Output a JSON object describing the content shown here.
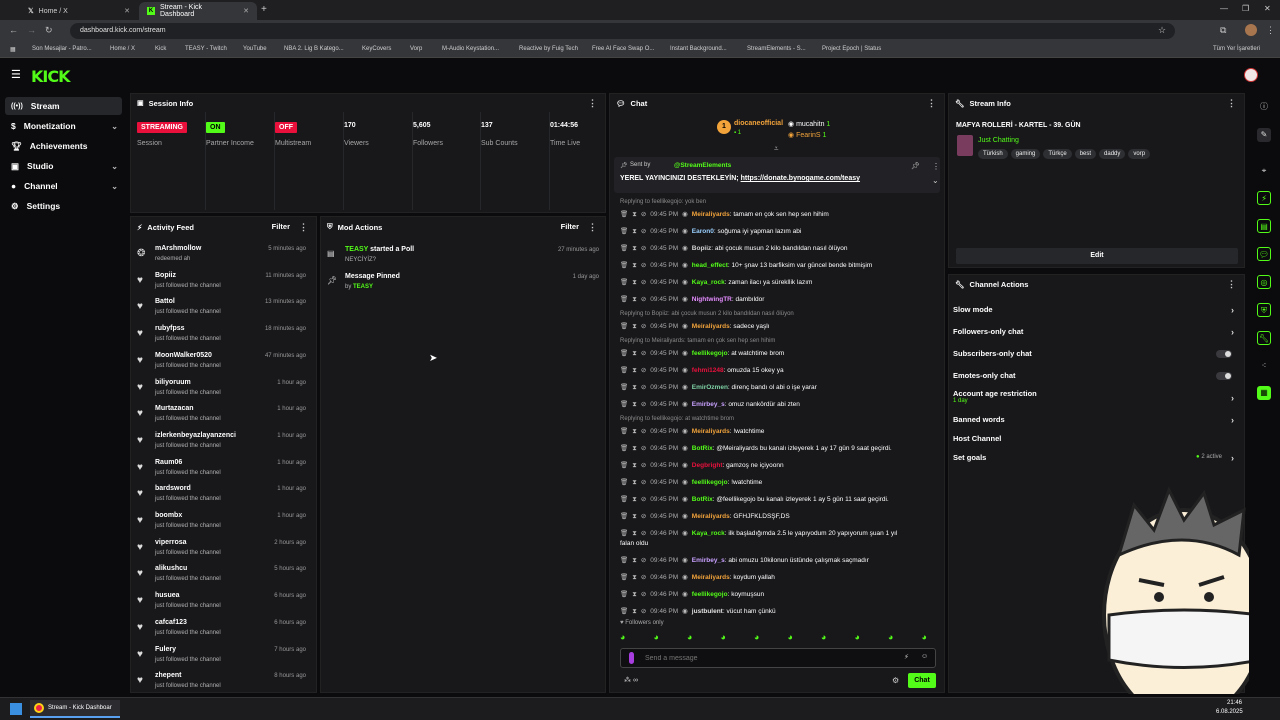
{
  "browser": {
    "tabs": [
      {
        "label": "Home / X",
        "icon": "x-icon"
      },
      {
        "label": "Stream - Kick Dashboard",
        "icon": "kick-icon"
      }
    ],
    "url": "dashboard.kick.com/stream",
    "bookmarks": [
      "Son Mesajlar - Patro...",
      "Home / X",
      "Kick",
      "TEASY - Twitch",
      "YouTube",
      "NBA 2. Lig B Katego...",
      "KeyCovers",
      "Vorp",
      "M-Audio Keystation...",
      "Reactive by Fuig Tech",
      "Free AI Face Swap O...",
      "Instant Background...",
      "StreamElements - S...",
      "Project Epoch | Status"
    ],
    "all_bookmarks": "Tüm Yer İşaretleri"
  },
  "logo": "KICK",
  "nav": [
    {
      "label": "Stream",
      "icon": "stream-icon",
      "active": true
    },
    {
      "label": "Monetization",
      "icon": "dollar-icon"
    },
    {
      "label": "Achievements",
      "icon": "trophy-icon"
    },
    {
      "label": "Studio",
      "icon": "studio-icon"
    },
    {
      "label": "Channel",
      "icon": "user-icon"
    },
    {
      "label": "Settings",
      "icon": "gear-icon"
    }
  ],
  "session": {
    "title": "Session Info",
    "stats": [
      {
        "badge": "STREAMING",
        "badge_color": "#e9113c",
        "label": "Session"
      },
      {
        "badge": "ON",
        "badge_color": "#53fc18",
        "label": "Partner Income"
      },
      {
        "badge": "OFF",
        "badge_color": "#e9113c",
        "label": "Multistream"
      },
      {
        "value": "170",
        "label": "Viewers"
      },
      {
        "value": "5,605",
        "label": "Followers"
      },
      {
        "value": "137",
        "label": "Sub Counts"
      },
      {
        "value": "01:44:56",
        "label": "Time Live"
      }
    ]
  },
  "activity": {
    "title": "Activity Feed",
    "filter": "Filter",
    "items": [
      {
        "name": "mArshmollow",
        "sub": "redeemed ah",
        "time": "5 minutes ago",
        "icon": "redeem-icon"
      },
      {
        "name": "Bopiiz",
        "sub": "just followed the channel",
        "time": "11 minutes ago"
      },
      {
        "name": "Battol",
        "sub": "just followed the channel",
        "time": "13 minutes ago"
      },
      {
        "name": "rubyfpss",
        "sub": "just followed the channel",
        "time": "18 minutes ago"
      },
      {
        "name": "MoonWalker0520",
        "sub": "just followed the channel",
        "time": "47 minutes ago"
      },
      {
        "name": "biliyoruum",
        "sub": "just followed the channel",
        "time": "1 hour ago"
      },
      {
        "name": "Murtazacan",
        "sub": "just followed the channel",
        "time": "1 hour ago"
      },
      {
        "name": "izlerkenbeyazlayanzenci",
        "sub": "just followed the channel",
        "time": "1 hour ago"
      },
      {
        "name": "Raum06",
        "sub": "just followed the channel",
        "time": "1 hour ago"
      },
      {
        "name": "bardsword",
        "sub": "just followed the channel",
        "time": "1 hour ago"
      },
      {
        "name": "boombx",
        "sub": "just followed the channel",
        "time": "1 hour ago"
      },
      {
        "name": "viperrosa",
        "sub": "just followed the channel",
        "time": "2 hours ago"
      },
      {
        "name": "alikushcu",
        "sub": "just followed the channel",
        "time": "5 hours ago"
      },
      {
        "name": "husuea",
        "sub": "just followed the channel",
        "time": "6 hours ago"
      },
      {
        "name": "cafcaf123",
        "sub": "just followed the channel",
        "time": "6 hours ago"
      },
      {
        "name": "Fulery",
        "sub": "just followed the channel",
        "time": "7 hours ago"
      },
      {
        "name": "zhepent",
        "sub": "just followed the channel",
        "time": "8 hours ago"
      }
    ]
  },
  "mod": {
    "title": "Mod Actions",
    "filter": "Filter",
    "items": [
      {
        "who": "TEASY",
        "action": " started a Poll",
        "sub": "NEYCİYİZ?",
        "time": "27 minutes ago",
        "icon": "poll-icon"
      },
      {
        "who": "",
        "action": "Message Pinned",
        "sub_prefix": "by ",
        "sub_who": "TEASY",
        "time": "1 day ago",
        "icon": "pin-icon"
      }
    ]
  },
  "chat": {
    "title": "Chat",
    "top": [
      {
        "name": "diocaneofficial",
        "count": "1",
        "rank": "1"
      },
      {
        "name": "mucahitn",
        "count": "1"
      },
      {
        "name": "FearinS",
        "count": "1"
      }
    ],
    "pinned": {
      "sent_by": "Sent by",
      "author": "@StreamElements",
      "text": "YEREL YAYINCINIZI DESTEKLEYİN; ",
      "link": "https://donate.bynogame.com/teasy"
    },
    "lines": [
      {
        "reply": "Replying to feellikegojo: yok ben"
      },
      {
        "ts": "09:45 PM",
        "user": "Meiraliyards",
        "color": "#f2a33a",
        "msg": "tamam en çok sen hep sen hihim"
      },
      {
        "ts": "09:45 PM",
        "user": "Earon0",
        "color": "#9ad0ff",
        "msg": "soğuma iyi yapman lazım abi"
      },
      {
        "ts": "09:45 PM",
        "user": "Bopiiz",
        "color": "#cfcfcf",
        "msg": "abi çocuk musun 2 kilo bandıldan nasıl ölüyon"
      },
      {
        "ts": "09:45 PM",
        "user": "head_effect",
        "color": "#53fc18",
        "msg": "10+ şnav 13 barfiksim var güncel bende bitmişim"
      },
      {
        "ts": "09:45 PM",
        "user": "Kaya_rock",
        "color": "#53fc18",
        "msg": "zaman ilacı ya sürekllik lazım"
      },
      {
        "ts": "09:45 PM",
        "user": "NightwingTR",
        "color": "#e58cff",
        "msg": "dambıldor"
      },
      {
        "reply": "Replying to Bopiiz: abi çocuk musun 2 kilo bandıldan nasıl ölüyon"
      },
      {
        "ts": "09:45 PM",
        "user": "Meiraliyards",
        "color": "#f2a33a",
        "msg": "sadece yaşlı"
      },
      {
        "reply": "Replying to Meiraliyards: tamam en çok sen hep sen hihim"
      },
      {
        "ts": "09:45 PM",
        "user": "feellikegojo",
        "color": "#53fc18",
        "msg": "at watchtime brom"
      },
      {
        "ts": "09:45 PM",
        "user": "fehmi1248",
        "color": "#e9113c",
        "msg": "omuzda 15 okey ya"
      },
      {
        "ts": "09:45 PM",
        "user": "EmirOzmen",
        "color": "#7fd3a6",
        "msg": "direnç bandı ol abi o işe yarar"
      },
      {
        "ts": "09:45 PM",
        "user": "Emirbey_s",
        "color": "#c9a1ff",
        "msg": "omuz nankördür abi zten"
      },
      {
        "reply": "Replying to feellikegojo: at watchtime brom"
      },
      {
        "ts": "09:45 PM",
        "user": "Meiraliyards",
        "color": "#f2a33a",
        "msg": "!watchtime"
      },
      {
        "ts": "09:45 PM",
        "user": "BotRix",
        "color": "#53fc18",
        "msg": "@Meiraliyards bu kanalı izleyerek 1 ay 17 gün 9 saat geçirdi."
      },
      {
        "ts": "09:45 PM",
        "user": "Degbright",
        "color": "#e9113c",
        "msg": "gamzoş ne içiyoonn"
      },
      {
        "ts": "09:45 PM",
        "user": "feellikegojo",
        "color": "#53fc18",
        "msg": "!watchtime"
      },
      {
        "ts": "09:45 PM",
        "user": "BotRix",
        "color": "#53fc18",
        "msg": "@feellikegojo bu kanalı izleyerek 1 ay 5 gün 11 saat geçirdi."
      },
      {
        "ts": "09:45 PM",
        "user": "Meiraliyards",
        "color": "#f2a33a",
        "msg": "GFHJFKLDSŞF,DS"
      },
      {
        "ts": "09:46 PM",
        "user": "Kaya_rock",
        "color": "#53fc18",
        "msg": "ilk başladığımda 2.5 le yapıyodum 20 yapıyorum şuan 1 yıl",
        "cont": "falan oldu"
      },
      {
        "ts": "09:46 PM",
        "user": "Emirbey_s",
        "color": "#c9a1ff",
        "msg": "abi omuzu 10kilonun üstünde çalışmak saçmadır"
      },
      {
        "ts": "09:46 PM",
        "user": "Meiraliyards",
        "color": "#f2a33a",
        "msg": "koydum yallah"
      },
      {
        "ts": "09:46 PM",
        "user": "feellikegojo",
        "color": "#53fc18",
        "msg": "koymuşsun"
      },
      {
        "ts": "09:46 PM",
        "user": "justbulent",
        "color": "#e0e0e0",
        "msg": "vücut ham çünkü"
      }
    ],
    "followers_only": "Followers only",
    "placeholder": "Send a message",
    "send": "Chat"
  },
  "stream_info": {
    "title": "Stream Info",
    "stream_title": "MAFYA ROLLERİ - KARTEL - 39. GÜN",
    "category": "Just Chatting",
    "tags": [
      "Türkish",
      "gaming",
      "Türkçe",
      "best",
      "daddy",
      "vorp"
    ],
    "edit": "Edit"
  },
  "channel_actions": {
    "title": "Channel Actions",
    "items": [
      {
        "label": "Slow mode",
        "kind": "chevron"
      },
      {
        "label": "Followers-only chat",
        "kind": "chevron"
      },
      {
        "label": "Subscribers-only chat",
        "kind": "toggle"
      },
      {
        "label": "Emotes-only chat",
        "kind": "toggle"
      },
      {
        "label": "Account age restriction",
        "sub": "1 day",
        "kind": "chevron"
      },
      {
        "label": "Banned words",
        "kind": "chevron"
      },
      {
        "label": "Host Channel",
        "kind": "none"
      },
      {
        "label": "Set goals",
        "extra": "2 active",
        "kind": "chevron"
      }
    ]
  },
  "taskbar": {
    "app": "Stream - Kick Dashboar",
    "time": "21:46",
    "date": "6.08.2025"
  },
  "colors": {
    "accent": "#53fc18",
    "danger": "#e9113c",
    "panel": "#18181b",
    "bg": "#0b0b0d"
  }
}
